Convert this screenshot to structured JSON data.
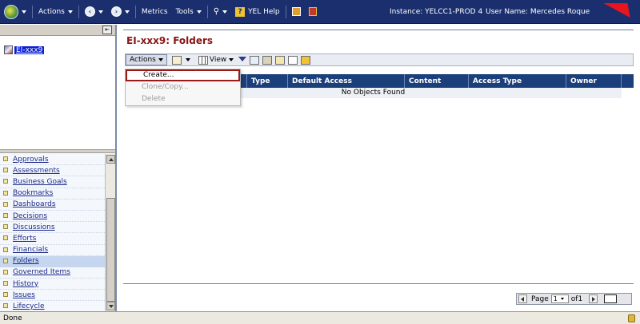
{
  "topbar": {
    "menus": [
      "Actions",
      "Metrics",
      "Tools"
    ],
    "help_label": "YEL Help",
    "instance_label": "Instance: YELCC1-PROD 4",
    "user_label": "User Name: Mercedes Roque"
  },
  "tree": {
    "selected_label": "EI-xxx9"
  },
  "nav": {
    "items": [
      "Approvals",
      "Assessments",
      "Business Goals",
      "Bookmarks",
      "Dashboards",
      "Decisions",
      "Discussions",
      "Efforts",
      "Financials",
      "Folders",
      "Governed Items",
      "History",
      "Issues",
      "Lifecycle"
    ],
    "active": "Folders"
  },
  "main": {
    "title": "EI-xxx9: Folders",
    "toolbar": {
      "actions_label": "Actions",
      "view_label": "View"
    },
    "columns": [
      "",
      "Type",
      "Default Access",
      "Content",
      "Access Type",
      "Owner"
    ],
    "empty_message": "No Objects Found",
    "actions_menu": [
      {
        "label": "Create...",
        "enabled": true
      },
      {
        "label": "Clone/Copy...",
        "enabled": false
      },
      {
        "label": "Delete",
        "enabled": false
      }
    ]
  },
  "pager": {
    "page_label": "Page",
    "page_value": "1",
    "of_label": "of1"
  },
  "status": {
    "text": "Done"
  },
  "colors": {
    "header_blue": "#1b2f6e",
    "title_red": "#8a1515",
    "table_header": "#1b3f7a"
  }
}
